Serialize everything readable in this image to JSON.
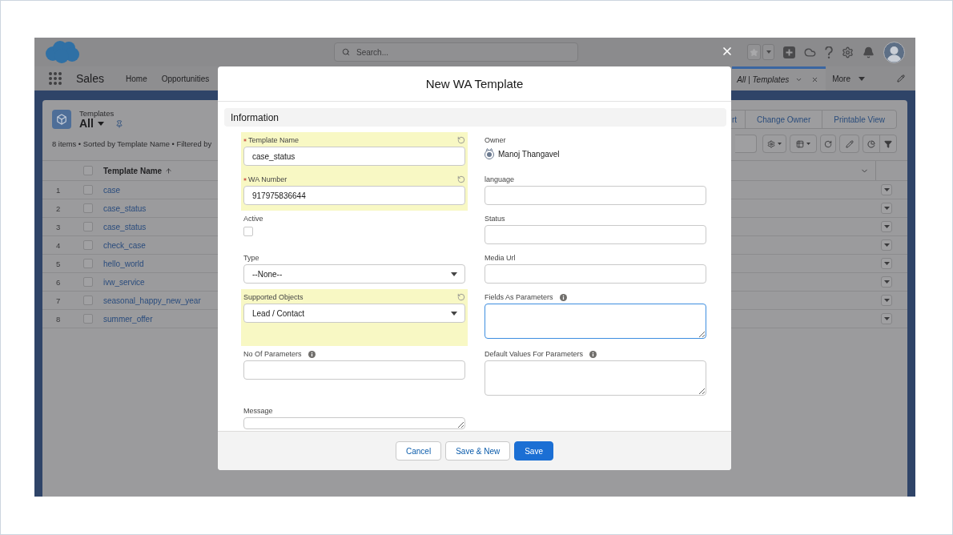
{
  "global_header": {
    "search": {
      "placeholder": "Search..."
    }
  },
  "nav_bar": {
    "app_name": "Sales",
    "items": [
      {
        "label": "Home"
      },
      {
        "label": "Opportunities"
      }
    ],
    "tabs": [
      {
        "label": "All | Templates",
        "selected": true
      }
    ],
    "more": {
      "label": "More"
    }
  },
  "list_view": {
    "object_label": "Templates",
    "view_name": "All",
    "actions": [
      {
        "label": "rt"
      },
      {
        "label": "Change Owner"
      },
      {
        "label": "Printable View"
      }
    ],
    "summary": "8 items • Sorted by Template Name • Filtered by",
    "select_all": false,
    "columns": [
      {
        "label": "Template Name",
        "sort_ascending": true
      }
    ],
    "rows": [
      {
        "number": "1",
        "name": "case",
        "selected": false
      },
      {
        "number": "2",
        "name": "case_status",
        "selected": false
      },
      {
        "number": "3",
        "name": "case_status",
        "selected": false
      },
      {
        "number": "4",
        "name": "check_case",
        "selected": false
      },
      {
        "number": "5",
        "name": "hello_world",
        "selected": false
      },
      {
        "number": "6",
        "name": "ivw_service",
        "selected": false
      },
      {
        "number": "7",
        "name": "seasonal_happy_new_year",
        "selected": false
      },
      {
        "number": "8",
        "name": "summer_offer",
        "selected": false
      }
    ]
  },
  "modal": {
    "title": "New WA Template",
    "section": "Information",
    "fields": [
      {
        "kind": "text",
        "label": "Template Name",
        "value": "case_status",
        "required": true,
        "changed": true,
        "info": false,
        "focused": false
      },
      {
        "kind": "owner",
        "label": "Owner",
        "value": "Manoj Thangavel",
        "required": false,
        "changed": false,
        "info": false
      },
      {
        "kind": "text",
        "label": "WA Number",
        "value": "917975836644",
        "required": true,
        "changed": true,
        "info": false,
        "focused": false
      },
      {
        "kind": "text",
        "label": "language",
        "required": false,
        "changed": false,
        "info": false,
        "focused": false
      },
      {
        "kind": "checkbox",
        "label": "Active",
        "checked": false,
        "required": false,
        "changed": false,
        "info": false
      },
      {
        "kind": "text",
        "label": "Status",
        "required": false,
        "changed": false,
        "info": false,
        "focused": false
      },
      {
        "kind": "select",
        "label": "Type",
        "value": "--None--",
        "required": false,
        "changed": false,
        "info": false,
        "focused": false
      },
      {
        "kind": "text",
        "label": "Media Url",
        "required": false,
        "changed": false,
        "info": false,
        "focused": false
      },
      {
        "kind": "select",
        "label": "Supported Objects",
        "value": "Lead / Contact",
        "required": false,
        "changed": true,
        "info": false,
        "focused": false
      },
      {
        "kind": "textarea",
        "label": "Fields As Parameters",
        "required": false,
        "changed": false,
        "info": true,
        "focused": true
      },
      {
        "kind": "text",
        "label": "No Of Parameters",
        "required": false,
        "changed": false,
        "info": true,
        "focused": false
      },
      {
        "kind": "textarea",
        "label": "Default Values For Parameters",
        "required": false,
        "changed": false,
        "info": true,
        "focused": false
      },
      {
        "kind": "textarea",
        "label": "Message",
        "required": false,
        "changed": false,
        "info": false,
        "focused": false
      }
    ],
    "buttons": [
      {
        "label": "Cancel",
        "kind": "neutral"
      },
      {
        "label": "Save & New",
        "kind": "neutral"
      },
      {
        "label": "Save",
        "kind": "brand"
      }
    ]
  }
}
